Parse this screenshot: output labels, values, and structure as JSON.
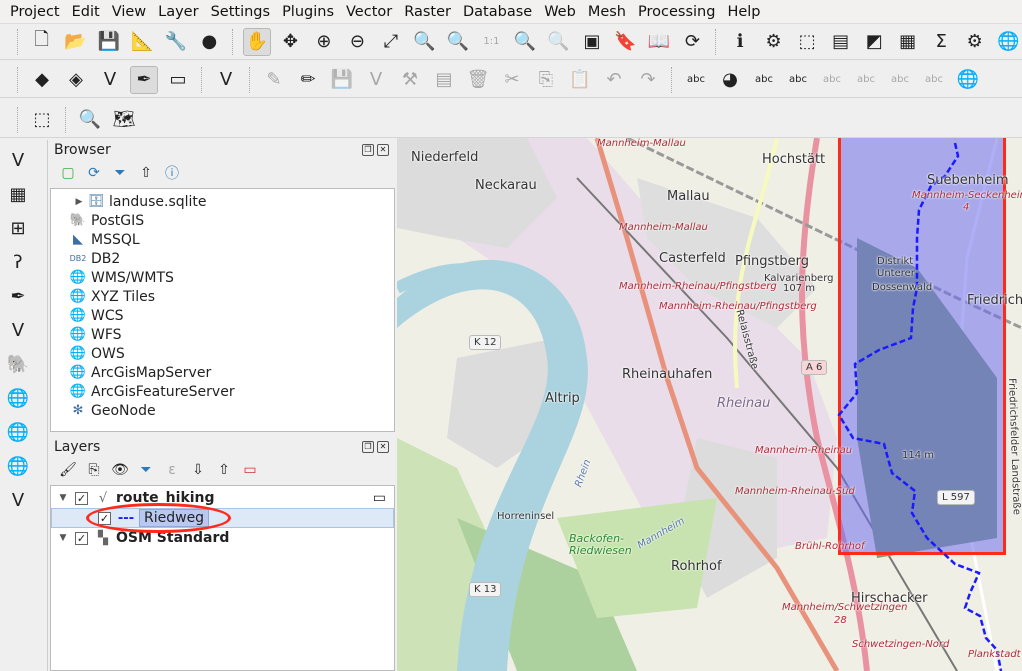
{
  "menubar": [
    "Project",
    "Edit",
    "View",
    "Layer",
    "Settings",
    "Plugins",
    "Vector",
    "Raster",
    "Database",
    "Web",
    "Mesh",
    "Processing",
    "Help"
  ],
  "toolbar1": [
    {
      "icon": "new-project-icon",
      "g": "🗋"
    },
    {
      "icon": "open-project-icon",
      "g": "📂"
    },
    {
      "icon": "save-project-icon",
      "g": "💾"
    },
    {
      "icon": "new-print-layout-icon",
      "g": "📐"
    },
    {
      "icon": "layout-manager-icon",
      "g": "🔧"
    },
    {
      "icon": "style-manager-icon",
      "g": "●"
    },
    {
      "icon": "pan-icon",
      "g": "✋",
      "on": true
    },
    {
      "icon": "pan-to-selection-icon",
      "g": "✥"
    },
    {
      "icon": "zoom-in-icon",
      "g": "⊕"
    },
    {
      "icon": "zoom-out-icon",
      "g": "⊖"
    },
    {
      "icon": "zoom-full-icon",
      "g": "⤢"
    },
    {
      "icon": "zoom-to-selection-icon",
      "g": "🔍"
    },
    {
      "icon": "zoom-to-layer-icon",
      "g": "🔍"
    },
    {
      "icon": "zoom-native-icon",
      "g": "1:1",
      "dis": true
    },
    {
      "icon": "zoom-last-icon",
      "g": "🔍"
    },
    {
      "icon": "zoom-next-icon",
      "g": "🔍",
      "dis": true
    },
    {
      "icon": "new-map-view-icon",
      "g": "▣"
    },
    {
      "icon": "temporal-controller-icon",
      "g": "🔖"
    },
    {
      "icon": "bookmarks-icon",
      "g": "📖"
    },
    {
      "icon": "refresh-icon",
      "g": "⟳"
    },
    {
      "icon": "identify-icon",
      "g": "ℹ"
    },
    {
      "icon": "select-by-location-icon",
      "g": "⚙"
    },
    {
      "icon": "select-features-icon",
      "g": "⬚"
    },
    {
      "icon": "attribute-selection-icon",
      "g": "▤"
    },
    {
      "icon": "deselect-icon",
      "g": "◩"
    },
    {
      "icon": "attribute-table-icon",
      "g": "▦"
    },
    {
      "icon": "statistics-icon",
      "g": "Σ"
    },
    {
      "icon": "processing-toolbox-icon",
      "g": "⚙"
    },
    {
      "icon": "web-icon",
      "g": "🌐"
    }
  ],
  "toolbar2": [
    {
      "icon": "data-source-manager-icon",
      "g": "◆"
    },
    {
      "icon": "new-geopackage-layer-icon",
      "g": "◈"
    },
    {
      "icon": "new-shapefile-layer-icon",
      "g": "V"
    },
    {
      "icon": "new-spatialite-layer-icon",
      "g": "✒",
      "on": true
    },
    {
      "icon": "new-temporary-layer-icon",
      "g": "▭"
    },
    {
      "icon": "new-virtual-layer-icon",
      "g": "V"
    },
    {
      "icon": "current-edits-icon",
      "g": "✎",
      "dis": true
    },
    {
      "icon": "toggle-editing-icon",
      "g": "✏"
    },
    {
      "icon": "save-edits-icon",
      "g": "💾",
      "dis": true
    },
    {
      "icon": "add-feature-icon",
      "g": "V",
      "dis": true
    },
    {
      "icon": "vertex-tool-icon",
      "g": "⚒",
      "dis": true
    },
    {
      "icon": "modify-attributes-icon",
      "g": "▤",
      "dis": true
    },
    {
      "icon": "delete-selected-icon",
      "g": "🗑",
      "dis": true
    },
    {
      "icon": "cut-features-icon",
      "g": "✂",
      "dis": true
    },
    {
      "icon": "copy-features-icon",
      "g": "⎘",
      "dis": true
    },
    {
      "icon": "paste-features-icon",
      "g": "📋",
      "dis": true
    },
    {
      "icon": "undo-icon",
      "g": "↶",
      "dis": true
    },
    {
      "icon": "redo-icon",
      "g": "↷",
      "dis": true
    },
    {
      "icon": "label-icon",
      "g": "abc"
    },
    {
      "icon": "diagram-icon",
      "g": "◕"
    },
    {
      "icon": "pin-label-icon",
      "g": "abc"
    },
    {
      "icon": "highlight-label-icon",
      "g": "abc"
    },
    {
      "icon": "show-hide-labels-icon",
      "g": "abc",
      "dis": true
    },
    {
      "icon": "move-label-icon",
      "g": "abc",
      "dis": true
    },
    {
      "icon": "rotate-label-icon",
      "g": "abc",
      "dis": true
    },
    {
      "icon": "change-label-icon",
      "g": "abc",
      "dis": true
    },
    {
      "icon": "metasearch-icon",
      "g": "🌐"
    }
  ],
  "toolbar3": [
    {
      "icon": "select-cursor-icon",
      "g": "⬚"
    },
    {
      "icon": "search-plugin-icon",
      "g": "🔍"
    },
    {
      "icon": "map-tool-icon",
      "g": "🗺"
    }
  ],
  "lefttoolbar": [
    {
      "icon": "add-vector-layer-icon",
      "g": "V"
    },
    {
      "icon": "add-raster-layer-icon",
      "g": "▦"
    },
    {
      "icon": "add-mesh-layer-icon",
      "g": "⊞"
    },
    {
      "icon": "add-delimited-text-icon",
      "g": "ʔ"
    },
    {
      "icon": "add-spatialite-icon",
      "g": "✒"
    },
    {
      "icon": "add-virtual-layer-icon",
      "g": "V"
    },
    {
      "icon": "add-postgis-icon",
      "g": "🐘"
    },
    {
      "icon": "add-wms-icon",
      "g": "🌐"
    },
    {
      "icon": "add-wcs-icon",
      "g": "🌐"
    },
    {
      "icon": "add-wfs-icon",
      "g": "🌐"
    },
    {
      "icon": "new-vector-icon",
      "g": "V"
    }
  ],
  "browser": {
    "title": "Browser",
    "items": [
      {
        "label": "landuse.sqlite",
        "icon": "database-icon",
        "g": "🗄",
        "indent": true
      },
      {
        "label": "PostGIS",
        "icon": "postgis-icon",
        "g": "🐘"
      },
      {
        "label": "MSSQL",
        "icon": "mssql-icon",
        "g": "◣"
      },
      {
        "label": "DB2",
        "icon": "db2-icon",
        "g": "DB2"
      },
      {
        "label": "WMS/WMTS",
        "icon": "wms-icon",
        "g": "🌐"
      },
      {
        "label": "XYZ Tiles",
        "icon": "xyz-icon",
        "g": "🌐"
      },
      {
        "label": "WCS",
        "icon": "wcs-icon",
        "g": "🌐"
      },
      {
        "label": "WFS",
        "icon": "wfs-icon",
        "g": "🌐"
      },
      {
        "label": "OWS",
        "icon": "ows-icon",
        "g": "🌐"
      },
      {
        "label": "ArcGisMapServer",
        "icon": "arcgis-map-icon",
        "g": "🌐"
      },
      {
        "label": "ArcGisFeatureServer",
        "icon": "arcgis-feature-icon",
        "g": "🌐"
      },
      {
        "label": "GeoNode",
        "icon": "geonode-icon",
        "g": "✻"
      }
    ]
  },
  "layers": {
    "title": "Layers",
    "items": [
      {
        "label": "route_hiking",
        "checked": true,
        "type": "group"
      },
      {
        "label": "Riedweg",
        "checked": true,
        "type": "child",
        "selected": true
      },
      {
        "label": "OSM Standard",
        "checked": true,
        "type": "raster"
      }
    ]
  },
  "map": {
    "labels": [
      {
        "t": "Niederfeld",
        "c": "place"
      },
      {
        "t": "Neckarau",
        "c": "place"
      },
      {
        "t": "Mallau",
        "c": "place"
      },
      {
        "t": "Hochstätt",
        "c": "place"
      },
      {
        "t": "Casterfeld",
        "c": "place"
      },
      {
        "t": "Pfingstberg",
        "c": "place"
      },
      {
        "t": "Kalvarienberg",
        "c": "small"
      },
      {
        "t": "107 m",
        "c": "small"
      },
      {
        "t": "Altrip",
        "c": "place"
      },
      {
        "t": "Rheinauhafen",
        "c": "place"
      },
      {
        "t": "Rheinau",
        "c": "place"
      },
      {
        "t": "Suebenheim",
        "c": "place"
      },
      {
        "t": "Friedrichs",
        "c": "place"
      },
      {
        "t": "Rohrhof",
        "c": "place"
      },
      {
        "t": "Hirschacker",
        "c": "place"
      },
      {
        "t": "Horreninsel",
        "c": "small"
      },
      {
        "t": "Backofen-",
        "c": "green"
      },
      {
        "t": "Riedwiesen",
        "c": "green"
      },
      {
        "t": "Distrikt",
        "c": "small"
      },
      {
        "t": "Unterer",
        "c": "small"
      },
      {
        "t": "Dossenwald",
        "c": "small"
      },
      {
        "t": "114 m",
        "c": "small"
      },
      {
        "t": "Mannheim-Mallau",
        "c": "station"
      },
      {
        "t": "Mannheim-Mallau",
        "c": "station"
      },
      {
        "t": "Mannheim-Rheinau/Pfingstberg",
        "c": "station"
      },
      {
        "t": "Mannheim-Rheinau/Pfingstberg",
        "c": "station"
      },
      {
        "t": "Mannheim-Rheinau",
        "c": "station"
      },
      {
        "t": "Mannheim-Rheinau-Süd",
        "c": "station"
      },
      {
        "t": "Brühl-Rohrhof",
        "c": "station"
      },
      {
        "t": "Mannheim/Schwetzingen",
        "c": "station"
      },
      {
        "t": "28",
        "c": "station"
      },
      {
        "t": "Schwetzingen-Nord",
        "c": "station"
      },
      {
        "t": "Plankstadt",
        "c": "station"
      },
      {
        "t": "Mannheim-Seckenheim",
        "c": "station"
      },
      {
        "t": "4",
        "c": "station"
      },
      {
        "t": "Relaisstraße",
        "c": "small"
      },
      {
        "t": "Friedrichsfelder Landstraße",
        "c": "small"
      },
      {
        "t": "Rhein",
        "c": "water"
      },
      {
        "t": "Mannheim",
        "c": "water"
      }
    ],
    "shields": [
      "K 12",
      "K 13",
      "A 6",
      "L 597"
    ],
    "colors": {
      "selection_box": "#ff2a1a",
      "selection_fill": "#7b7bf0",
      "route": "#1a1aff",
      "water": "#aad3df",
      "forest": "#add19e"
    }
  },
  "highlight_color": "#ff2a1a"
}
